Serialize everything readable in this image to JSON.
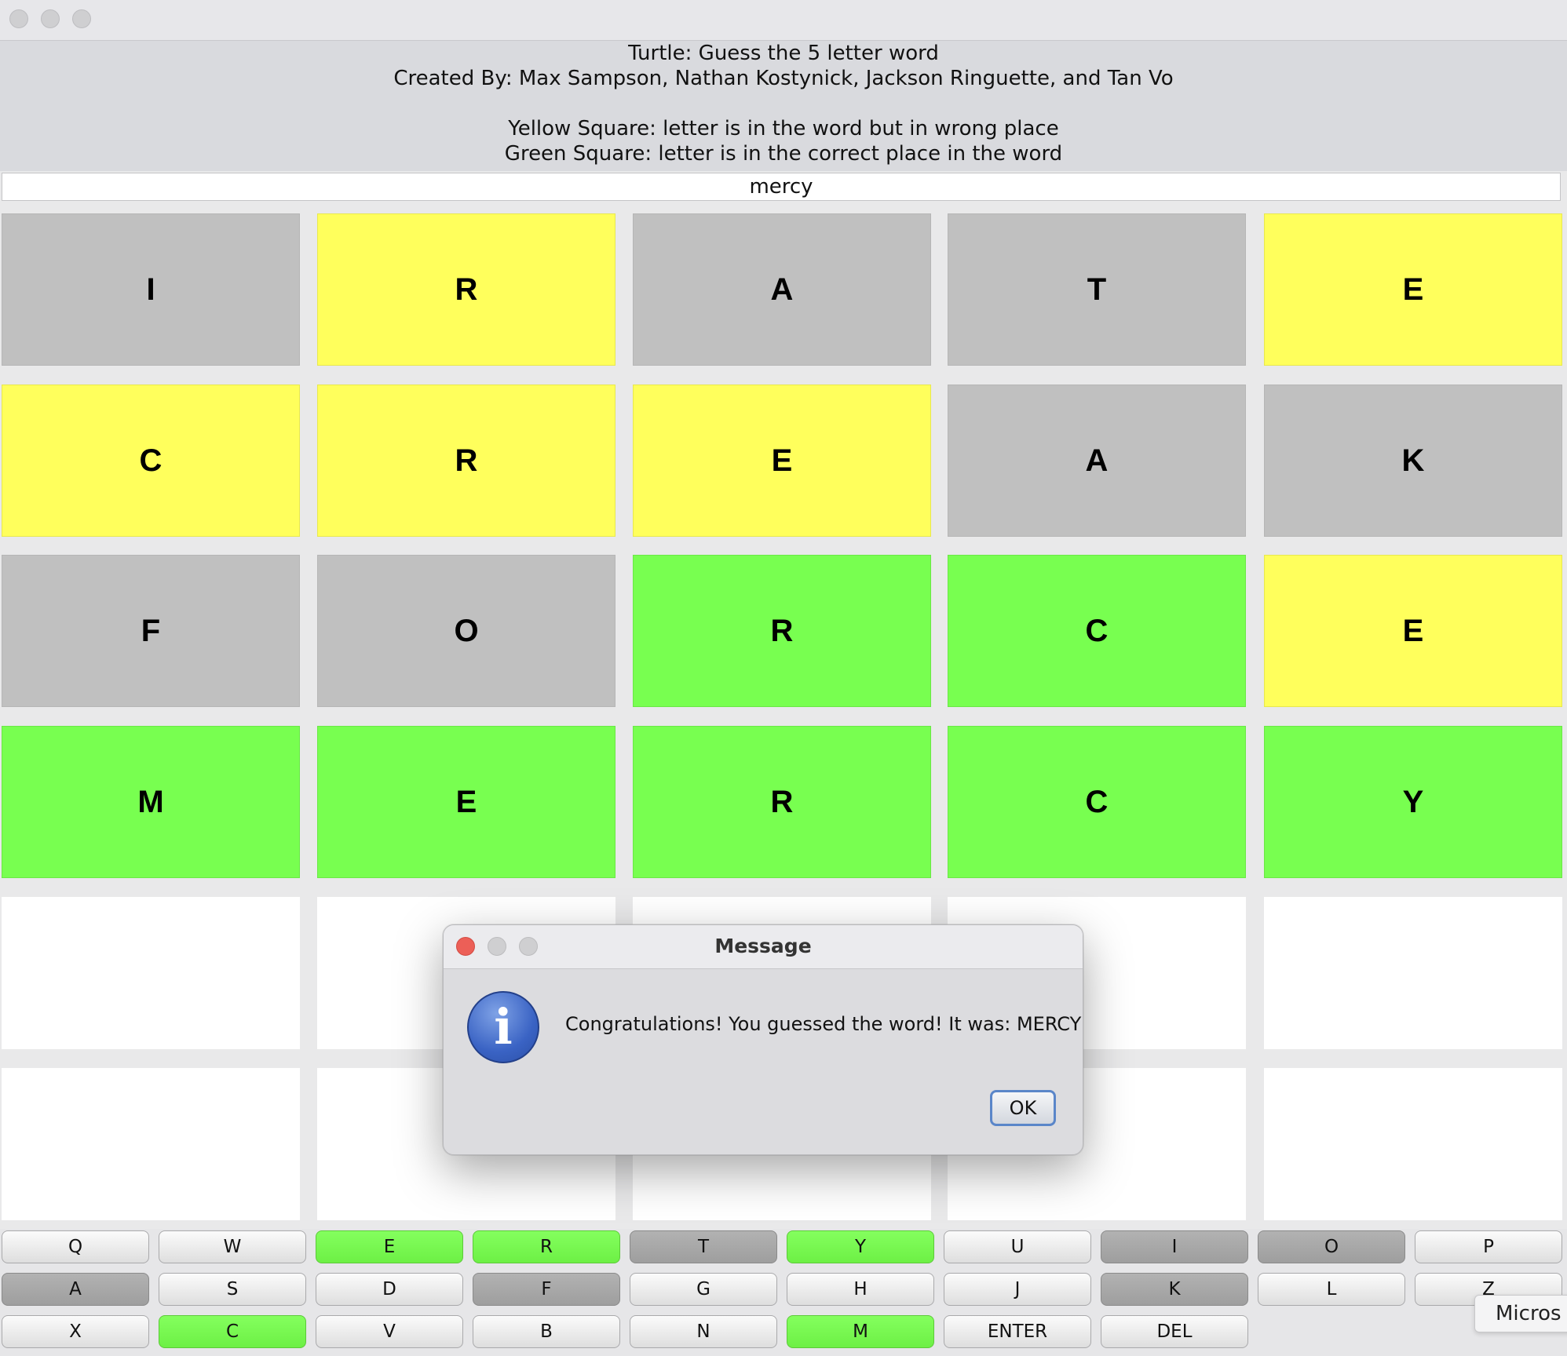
{
  "header": {
    "title": "Turtle: Guess the 5 letter word",
    "credits": "Created By: Max Sampson, Nathan Kostynick, Jackson Ringuette, and Tan Vo",
    "legend_yellow": "Yellow Square: letter is in the word but in wrong place",
    "legend_green": "Green Square: letter is in the correct place in the word"
  },
  "input": {
    "value": "mercy"
  },
  "colors": {
    "gray": "#c0c0c0",
    "yellow": "#ffff5c",
    "green": "#78ff50",
    "empty": "#ffffff"
  },
  "grid": {
    "rows": [
      [
        {
          "letter": "I",
          "state": "gray"
        },
        {
          "letter": "R",
          "state": "yellow"
        },
        {
          "letter": "A",
          "state": "gray"
        },
        {
          "letter": "T",
          "state": "gray"
        },
        {
          "letter": "E",
          "state": "yellow"
        }
      ],
      [
        {
          "letter": "C",
          "state": "yellow"
        },
        {
          "letter": "R",
          "state": "yellow"
        },
        {
          "letter": "E",
          "state": "yellow"
        },
        {
          "letter": "A",
          "state": "gray"
        },
        {
          "letter": "K",
          "state": "gray"
        }
      ],
      [
        {
          "letter": "F",
          "state": "gray"
        },
        {
          "letter": "O",
          "state": "gray"
        },
        {
          "letter": "R",
          "state": "green"
        },
        {
          "letter": "C",
          "state": "green"
        },
        {
          "letter": "E",
          "state": "yellow"
        }
      ],
      [
        {
          "letter": "M",
          "state": "green"
        },
        {
          "letter": "E",
          "state": "green"
        },
        {
          "letter": "R",
          "state": "green"
        },
        {
          "letter": "C",
          "state": "green"
        },
        {
          "letter": "Y",
          "state": "green"
        }
      ],
      [
        {
          "letter": "",
          "state": "empty"
        },
        {
          "letter": "",
          "state": "empty"
        },
        {
          "letter": "",
          "state": "empty"
        },
        {
          "letter": "",
          "state": "empty"
        },
        {
          "letter": "",
          "state": "empty"
        }
      ],
      [
        {
          "letter": "",
          "state": "empty"
        },
        {
          "letter": "",
          "state": "empty"
        },
        {
          "letter": "",
          "state": "empty"
        },
        {
          "letter": "",
          "state": "empty"
        },
        {
          "letter": "",
          "state": "empty"
        }
      ]
    ]
  },
  "keyboard": {
    "rows": [
      [
        {
          "label": "Q",
          "state": "default"
        },
        {
          "label": "W",
          "state": "default"
        },
        {
          "label": "E",
          "state": "green"
        },
        {
          "label": "R",
          "state": "green"
        },
        {
          "label": "T",
          "state": "gray"
        },
        {
          "label": "Y",
          "state": "green"
        },
        {
          "label": "U",
          "state": "default"
        },
        {
          "label": "I",
          "state": "gray"
        },
        {
          "label": "O",
          "state": "gray"
        },
        {
          "label": "P",
          "state": "default"
        }
      ],
      [
        {
          "label": "A",
          "state": "gray"
        },
        {
          "label": "S",
          "state": "default"
        },
        {
          "label": "D",
          "state": "default"
        },
        {
          "label": "F",
          "state": "gray"
        },
        {
          "label": "G",
          "state": "default"
        },
        {
          "label": "H",
          "state": "default"
        },
        {
          "label": "J",
          "state": "default"
        },
        {
          "label": "K",
          "state": "gray"
        },
        {
          "label": "L",
          "state": "default"
        },
        {
          "label": "Z",
          "state": "default"
        }
      ],
      [
        {
          "label": "X",
          "state": "default"
        },
        {
          "label": "C",
          "state": "green"
        },
        {
          "label": "V",
          "state": "default"
        },
        {
          "label": "B",
          "state": "default"
        },
        {
          "label": "N",
          "state": "default"
        },
        {
          "label": "M",
          "state": "green"
        },
        {
          "label": "ENTER",
          "state": "default"
        },
        {
          "label": "DEL",
          "state": "default"
        }
      ]
    ]
  },
  "dialog": {
    "title": "Message",
    "icon": "info-icon",
    "icon_glyph": "i",
    "message": "Congratulations! You guessed the word! It was: MERCY",
    "ok_label": "OK"
  },
  "tooltip": {
    "text": "Micros"
  }
}
